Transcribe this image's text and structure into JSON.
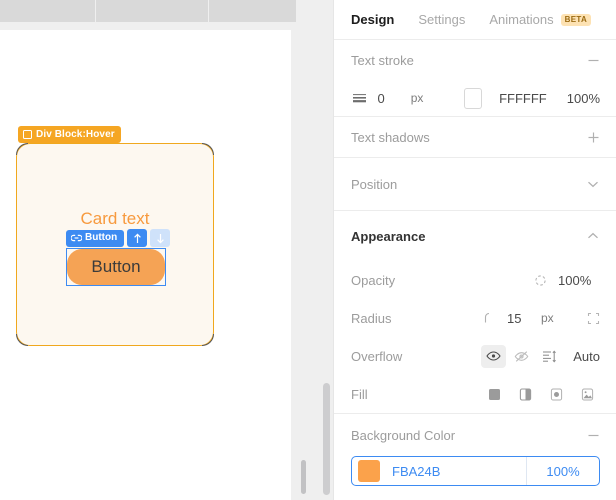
{
  "canvas": {
    "element_badge": {
      "label": "Div Block:Hover",
      "icon": "square-outline-icon"
    },
    "card_text": "Card text",
    "selection_toolbar": {
      "chip_label": "Button",
      "chip_icon": "link-icon",
      "move_up_icon": "arrow-up-icon",
      "move_down_icon": "arrow-down-icon"
    },
    "selected_button_label": "Button"
  },
  "panel": {
    "tabs": [
      {
        "label": "Design",
        "selected": true
      },
      {
        "label": "Settings",
        "selected": false
      },
      {
        "label": "Animations",
        "selected": false,
        "badge": "BETA"
      }
    ],
    "sections": {
      "text_stroke": {
        "title": "Text stroke",
        "collapse_icon": "minus-icon",
        "weight_icon": "stroke-weight-icon",
        "width_value": "0",
        "width_unit": "px",
        "color_swatch": "#FFFFFF",
        "color_hex": "FFFFFF",
        "color_opacity": "100%"
      },
      "text_shadows": {
        "title": "Text shadows",
        "add_icon": "plus-icon"
      },
      "position": {
        "title": "Position",
        "collapse_icon": "chevron-down-icon"
      },
      "appearance": {
        "title": "Appearance",
        "collapse_icon": "chevron-up-icon",
        "opacity": {
          "label": "Opacity",
          "icon": "opacity-icon",
          "value": "100%"
        },
        "radius": {
          "label": "Radius",
          "icon": "corner-radius-icon",
          "value": "15",
          "unit": "px",
          "corners_icon": "individual-corners-icon"
        },
        "overflow": {
          "label": "Overflow",
          "visible_icon": "eye-icon",
          "hidden_icon": "eye-off-icon",
          "scroll_icon": "scroll-icon",
          "auto_label": "Auto",
          "selected": "visible"
        },
        "fill": {
          "label": "Fill",
          "options": [
            "solid-fill-icon",
            "linear-gradient-icon",
            "radial-gradient-icon",
            "image-fill-icon"
          ]
        }
      },
      "background_color": {
        "title": "Background Color",
        "collapse_icon": "minus-icon",
        "swatch": "#FBA24B",
        "hex": "FBA24B",
        "opacity": "100%"
      }
    }
  }
}
